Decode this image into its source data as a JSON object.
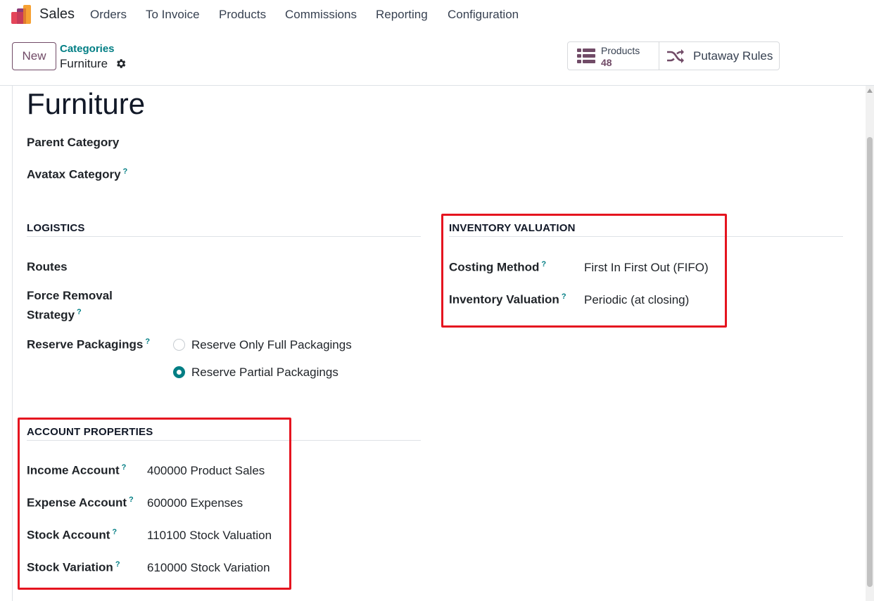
{
  "app": {
    "name": "Sales",
    "logo_icon": "odoo-sales-logo-icon"
  },
  "nav": {
    "items": [
      {
        "label": "Orders"
      },
      {
        "label": "To Invoice"
      },
      {
        "label": "Products"
      },
      {
        "label": "Commissions"
      },
      {
        "label": "Reporting"
      },
      {
        "label": "Configuration"
      }
    ]
  },
  "control": {
    "new_label": "New",
    "breadcrumb_parent": "Categories",
    "breadcrumb_current": "Furniture",
    "gear_icon": "gear-icon",
    "smart_buttons": {
      "products_label": "Products",
      "products_count": "48",
      "putaway_label": "Putaway Rules"
    }
  },
  "record": {
    "title": "Furniture",
    "fields": {
      "parent_category_label": "Parent Category",
      "avatax_category_label": "Avatax Category",
      "help_mark": "?"
    },
    "logistics": {
      "title": "LOGISTICS",
      "routes_label": "Routes",
      "force_removal_line1": "Force Removal",
      "force_removal_line2": "Strategy",
      "reserve_packagings_label": "Reserve Packagings",
      "options": [
        {
          "label": "Reserve Only Full Packagings",
          "checked": false
        },
        {
          "label": "Reserve Partial Packagings",
          "checked": true
        }
      ]
    },
    "inventory_valuation": {
      "title": "INVENTORY VALUATION",
      "costing_method_label": "Costing Method",
      "costing_method_value": "First In First Out (FIFO)",
      "inventory_valuation_label": "Inventory Valuation",
      "inventory_valuation_value": "Periodic (at closing)"
    },
    "account_properties": {
      "title": "ACCOUNT PROPERTIES",
      "rows": [
        {
          "label": "Income Account",
          "value": "400000 Product Sales"
        },
        {
          "label": "Expense Account",
          "value": "600000 Expenses"
        },
        {
          "label": "Stock Account",
          "value": "110100 Stock Valuation"
        },
        {
          "label": "Stock Variation",
          "value": "610000 Stock Variation"
        }
      ]
    }
  },
  "colors": {
    "brand": "#714b67",
    "accent": "#017e84",
    "highlight": "#e5141f"
  }
}
